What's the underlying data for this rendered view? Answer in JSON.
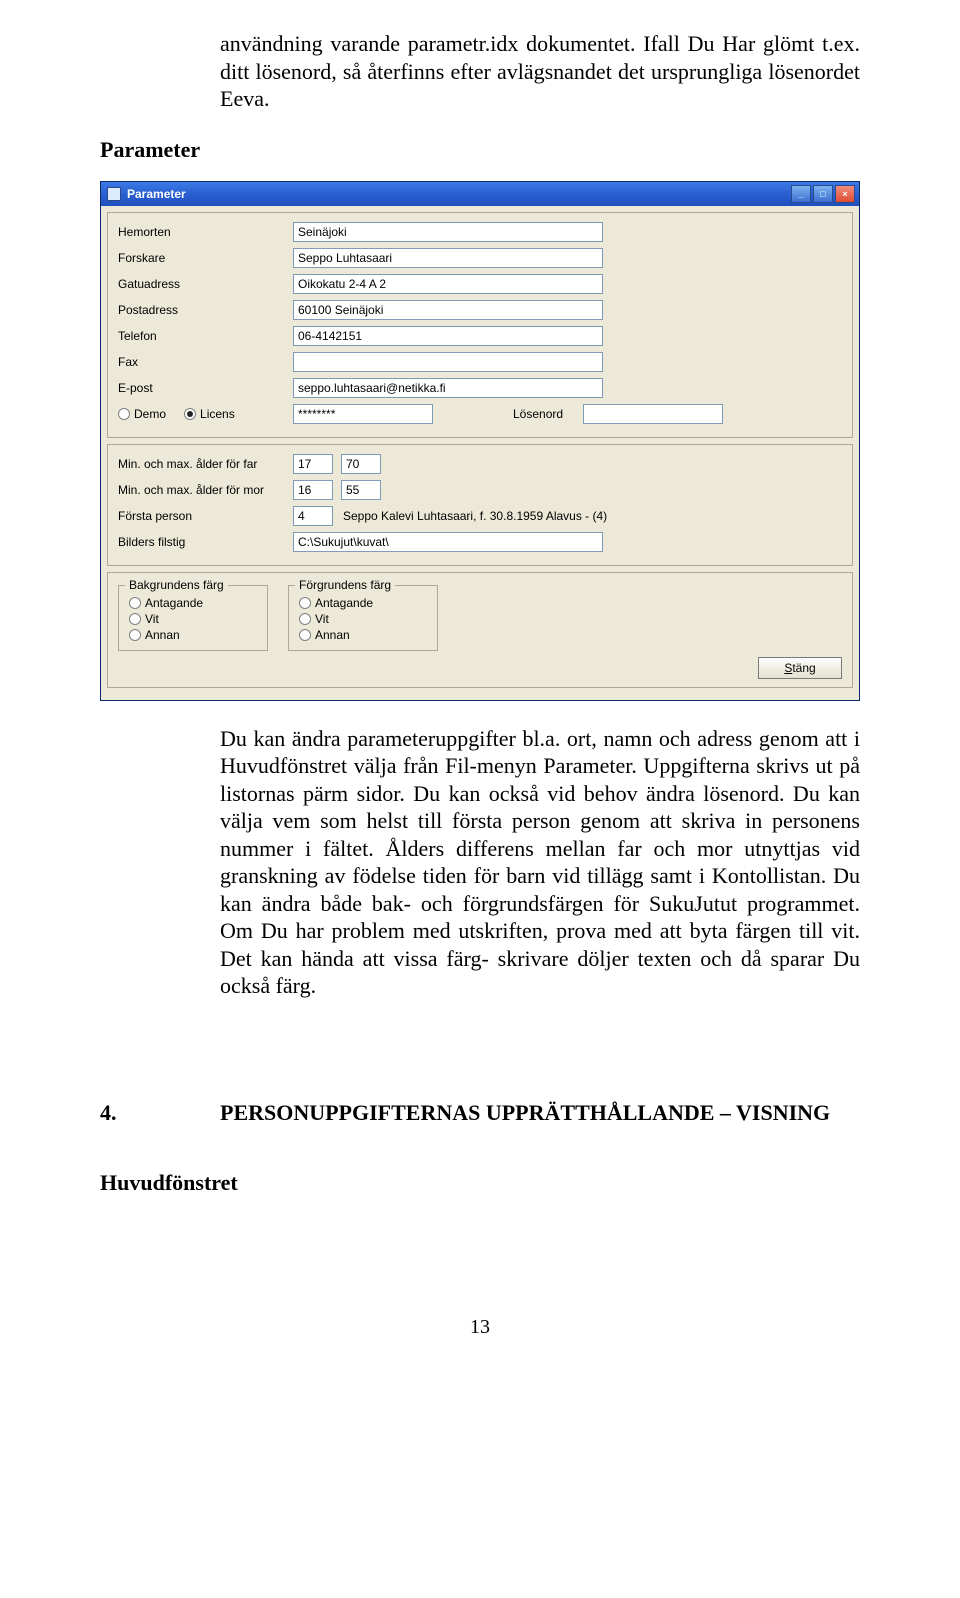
{
  "intro": "användning varande parametr.idx dokumentet. Ifall Du Har glömt t.ex. ditt lösenord, så återfinns efter avlägsnandet det ursprungliga lösenordet Eeva.",
  "section_heading": "Parameter",
  "window": {
    "title": "Parameter",
    "labels": {
      "hemorten": "Hemorten",
      "forskare": "Forskare",
      "gatuadress": "Gatuadress",
      "postadress": "Postadress",
      "telefon": "Telefon",
      "fax": "Fax",
      "epost": "E-post",
      "demo": "Demo",
      "licens": "Licens",
      "losenord": "Lösenord",
      "min_far": "Min. och max. ålder för far",
      "min_mor": "Min. och max. ålder för mor",
      "forsta_person": "Första person",
      "bilders_filstig": "Bilders filstig",
      "bakgrund": "Bakgrundens färg",
      "forgrund": "Förgrundens  färg",
      "antagande": "Antagande",
      "vit": "Vit",
      "annan": "Annan",
      "stang": "Stäng"
    },
    "values": {
      "hemorten": "Seinäjoki",
      "forskare": "Seppo Luhtasaari",
      "gatuadress": "Oikokatu 2-4 A 2",
      "postadress": "60100 Seinäjoki",
      "telefon": "06-4142151",
      "fax": "",
      "epost": "seppo.luhtasaari@netikka.fi",
      "licens_code": "********",
      "losenord": "",
      "far_min": "17",
      "far_max": "70",
      "mor_min": "16",
      "mor_max": "55",
      "forsta_person": "4",
      "forsta_person_info": "Seppo Kalevi Luhtasaari, f. 30.8.1959 Alavus - (4)",
      "bilders_filstig": "C:\\Sukujut\\kuvat\\"
    }
  },
  "body_paragraph": "Du kan ändra parameteruppgifter bl.a. ort, namn och adress genom att i Huvudfönstret välja från Fil-menyn Parameter. Uppgifterna skrivs ut på listornas pärm sidor. Du kan också vid behov ändra lösenord. Du kan välja vem som helst till första person genom att skriva in personens nummer i fältet. Ålders differens mellan far och mor utnyttjas vid granskning av födelse tiden för barn vid tillägg samt i Kontollistan. Du kan ändra både bak- och förgrundsfärgen för SukuJutut programmet. Om Du har problem med utskriften, prova med att byta färgen till vit. Det kan hända att vissa färg- skrivare döljer texten och då sparar Du också färg.",
  "section4": {
    "number": "4.",
    "title": "PERSONUPPGIFTERNAS UPPRÄTTHÅLLANDE – VISNING"
  },
  "sub_heading": "Huvudfönstret",
  "page_number": "13"
}
